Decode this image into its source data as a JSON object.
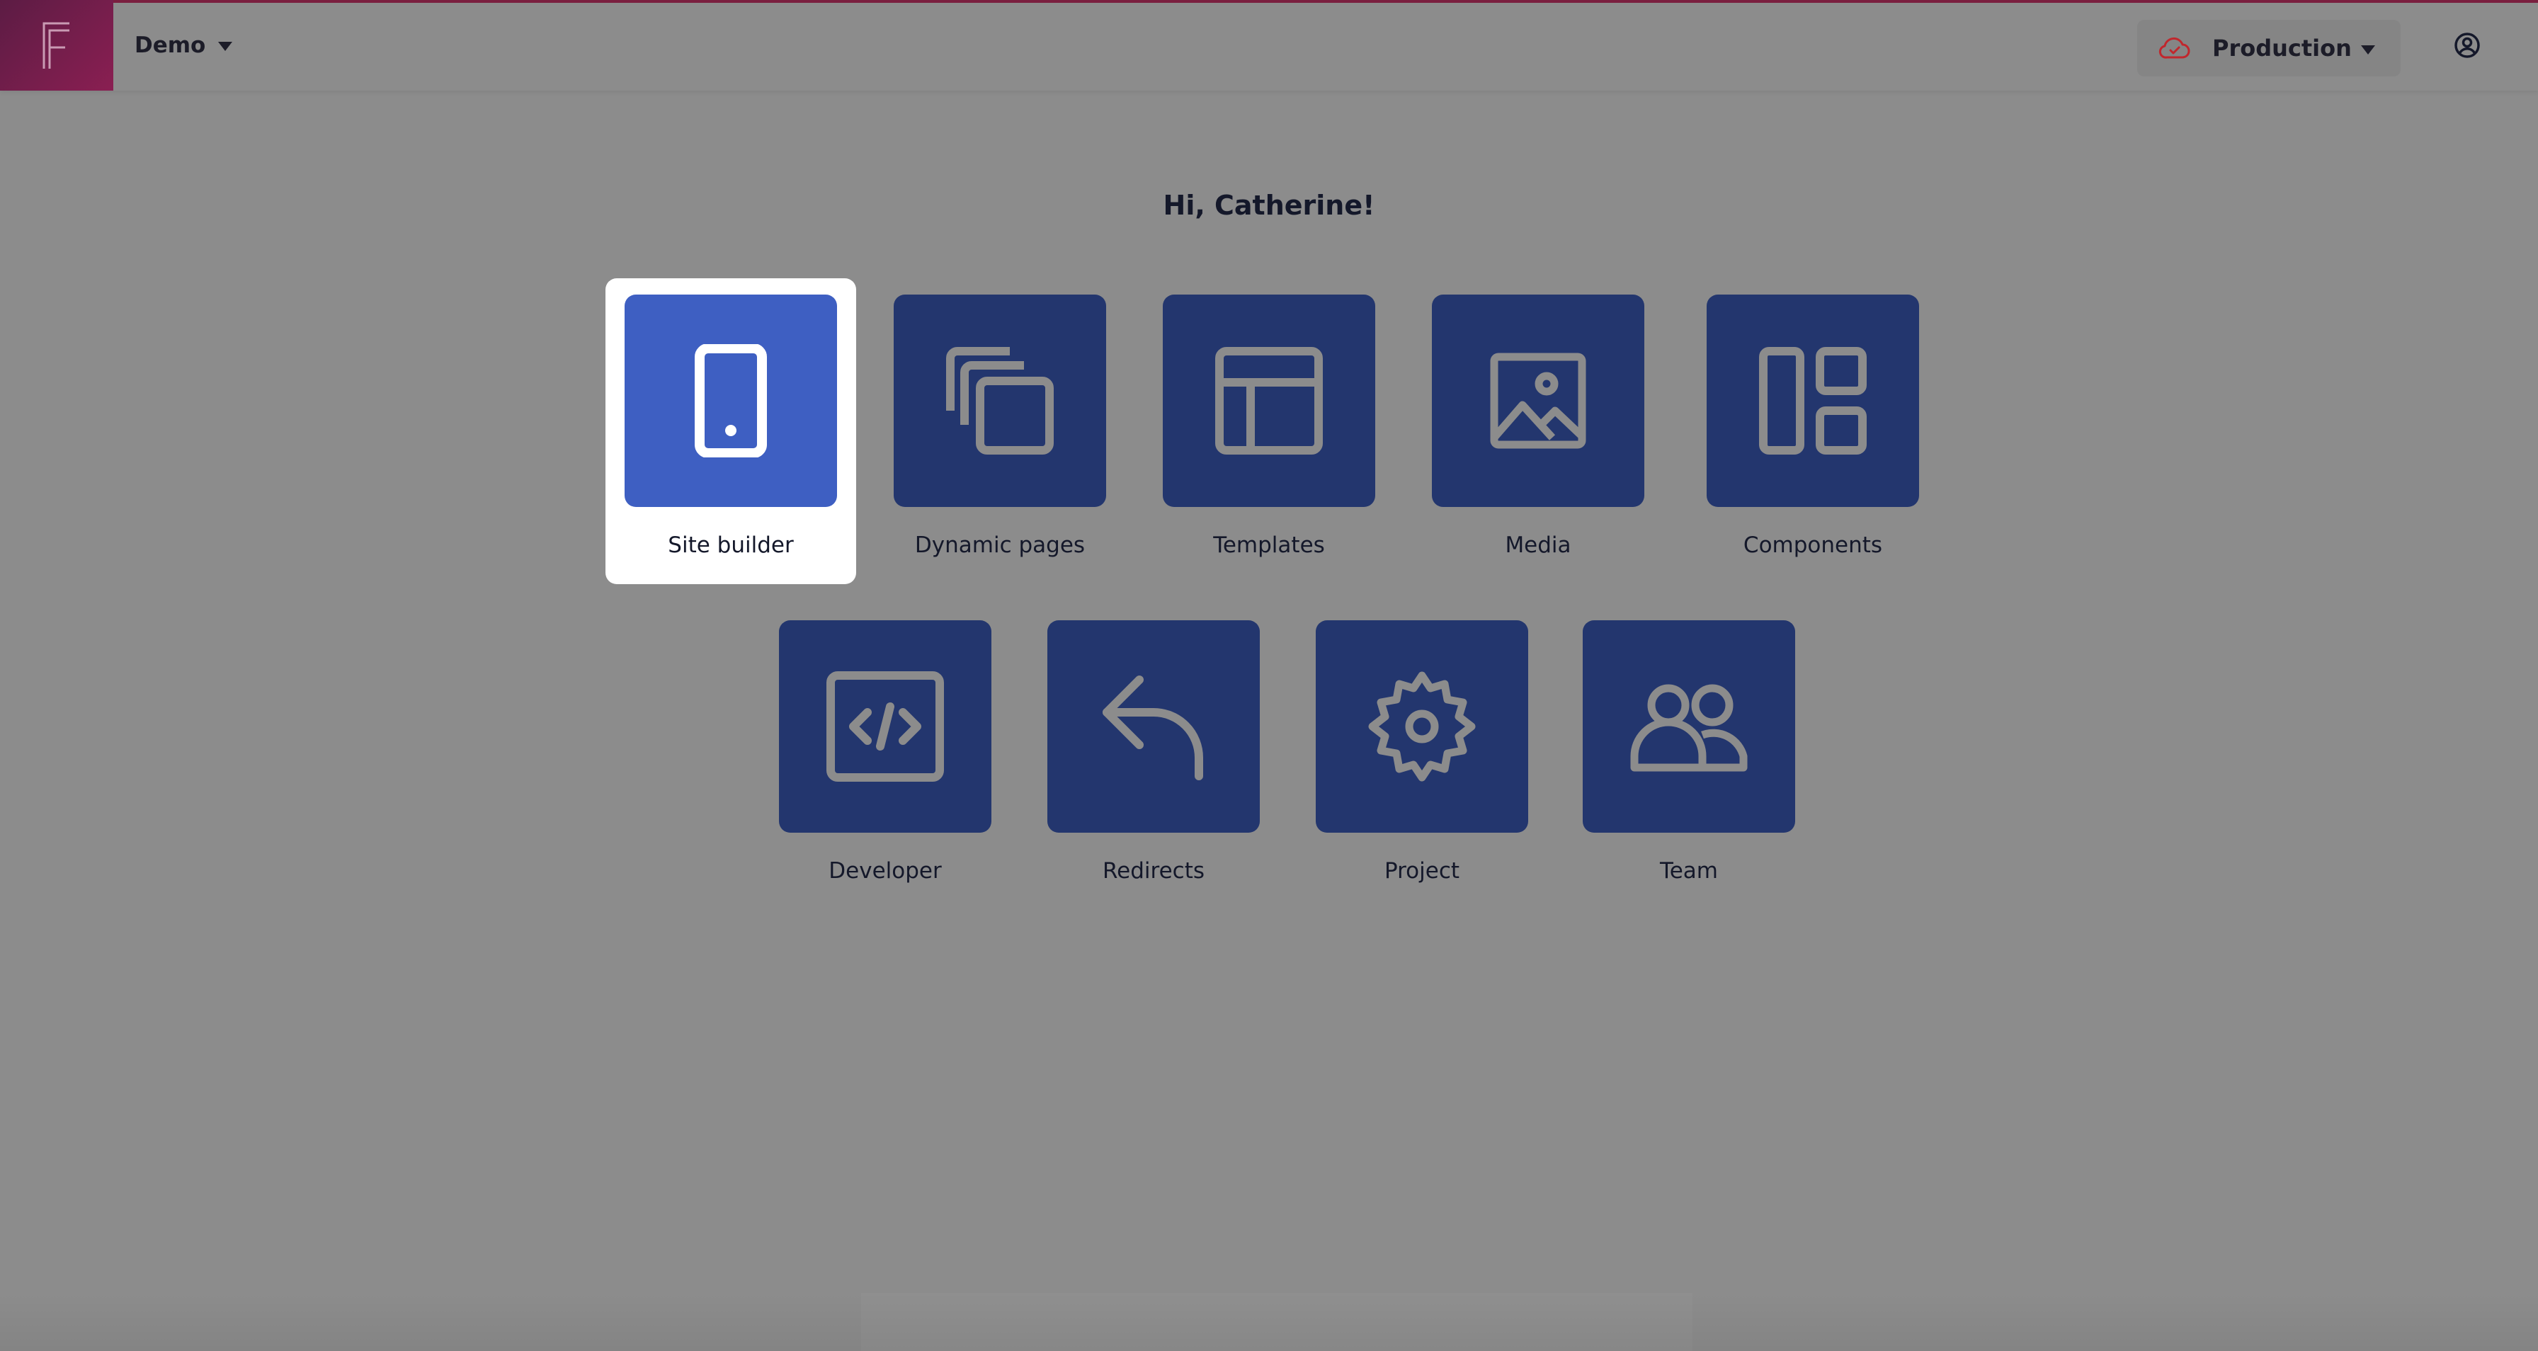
{
  "header": {
    "project_name": "Demo",
    "environment": "Production"
  },
  "greeting": "Hi, Catherine!",
  "apps": [
    {
      "label": "Site builder",
      "icon": "mobile-icon",
      "selected": true
    },
    {
      "label": "Dynamic pages",
      "icon": "copy-pages-icon",
      "selected": false
    },
    {
      "label": "Templates",
      "icon": "layout-icon",
      "selected": false
    },
    {
      "label": "Media",
      "icon": "image-icon",
      "selected": false
    },
    {
      "label": "Components",
      "icon": "dashboard-icon",
      "selected": false
    },
    {
      "label": "Developer",
      "icon": "code-icon",
      "selected": false
    },
    {
      "label": "Redirects",
      "icon": "reply-arrow-icon",
      "selected": false
    },
    {
      "label": "Project",
      "icon": "gear-icon",
      "selected": false
    },
    {
      "label": "Team",
      "icon": "users-icon",
      "selected": false
    }
  ],
  "colors": {
    "tile": "#23366e",
    "tile_selected": "#3e5fc2",
    "logo_gradient_start": "#5c1c44",
    "logo_gradient_end": "#8a1f52",
    "cloud_icon": "#c1272d"
  }
}
